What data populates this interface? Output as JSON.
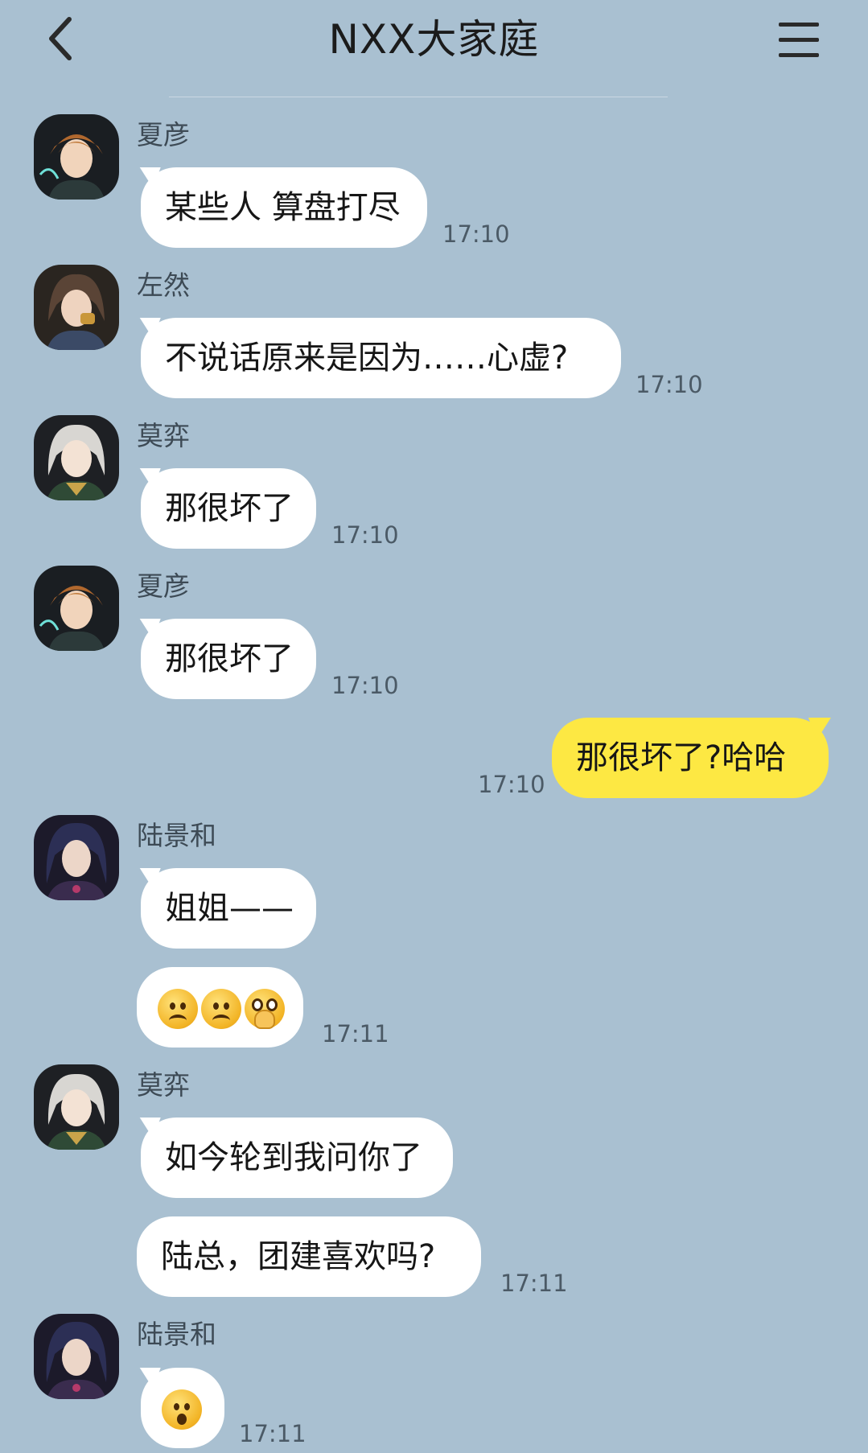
{
  "header": {
    "title": "NXX大家庭",
    "back_icon": "chevron-left-icon",
    "menu_icon": "hamburger-menu-icon"
  },
  "colors": {
    "background": "#a9c0d1",
    "incoming_bubble": "#ffffff",
    "outgoing_bubble": "#fde843"
  },
  "messages": [
    {
      "sender": "夏彦",
      "text": "某些人 算盘打尽",
      "time": "17:10",
      "avatar": "avatar-xiayan"
    },
    {
      "sender": "左然",
      "text": "不说话原来是因为……心虚?",
      "time": "17:10",
      "avatar": "avatar-zuoran"
    },
    {
      "sender": "莫弈",
      "text": "那很坏了",
      "time": "17:10",
      "avatar": "avatar-moyi"
    },
    {
      "sender": "夏彦",
      "text": "那很坏了",
      "time": "17:10",
      "avatar": "avatar-xiayan"
    },
    {
      "sender": "",
      "text": "那很坏了?哈哈",
      "time": "17:10",
      "outgoing": true
    },
    {
      "sender": "陆景和",
      "text": "姐姐——",
      "time": "",
      "avatar": "avatar-lujinghe"
    },
    {
      "sender": "",
      "text": "",
      "time": "17:11",
      "emojis": [
        "frowning-face-icon",
        "frowning-face-icon",
        "pleading-hands-face-icon"
      ]
    },
    {
      "sender": "莫弈",
      "text": "如今轮到我问你了",
      "time": "",
      "avatar": "avatar-moyi"
    },
    {
      "sender": "",
      "text": "陆总，团建喜欢吗?",
      "time": "17:11"
    },
    {
      "sender": "陆景和",
      "text": "",
      "time": "17:11",
      "avatar": "avatar-lujinghe",
      "emojis": [
        "shushing-face-icon"
      ]
    }
  ]
}
